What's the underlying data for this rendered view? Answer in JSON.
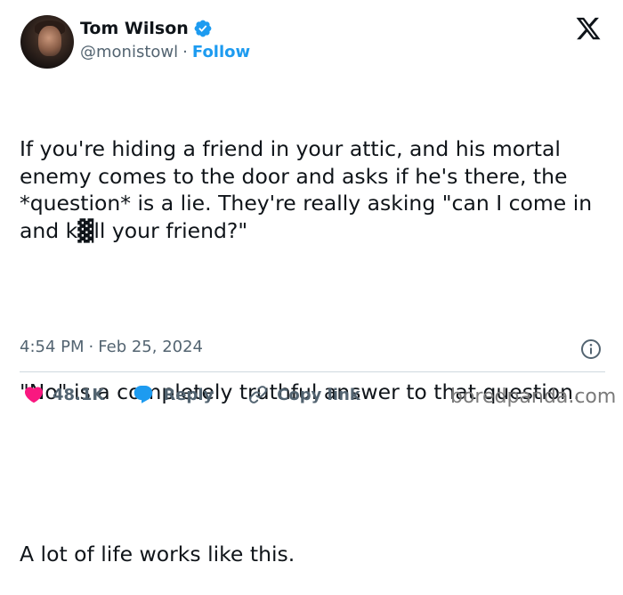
{
  "author": {
    "name": "Tom Wilson",
    "handle": "@monistowl",
    "separator": "·",
    "follow_label": "Follow"
  },
  "tweet": {
    "paragraphs": [
      "If you're hiding a friend in your attic, and his mortal enemy comes to the door and asks if he's there, the *question* is a lie. They're really asking \"can I come in and k▓ll your friend?\"",
      "\"No\" is a completely truthful answer to that question.",
      "A lot of life works like this."
    ],
    "time": "4:54 PM",
    "separator": "·",
    "date": "Feb 25, 2024"
  },
  "actions": {
    "likes": "48.1K",
    "reply_label": "Reply",
    "copy_link_label": "Copy link"
  },
  "watermark": "boredpanda.com",
  "colors": {
    "accent": "#1d9bf0",
    "like": "#f91880",
    "text": "#0f1419",
    "muted": "#536471"
  },
  "icons": [
    "verified-badge-icon",
    "x-logo-icon",
    "info-icon",
    "heart-icon",
    "reply-bubble-icon",
    "link-icon"
  ]
}
